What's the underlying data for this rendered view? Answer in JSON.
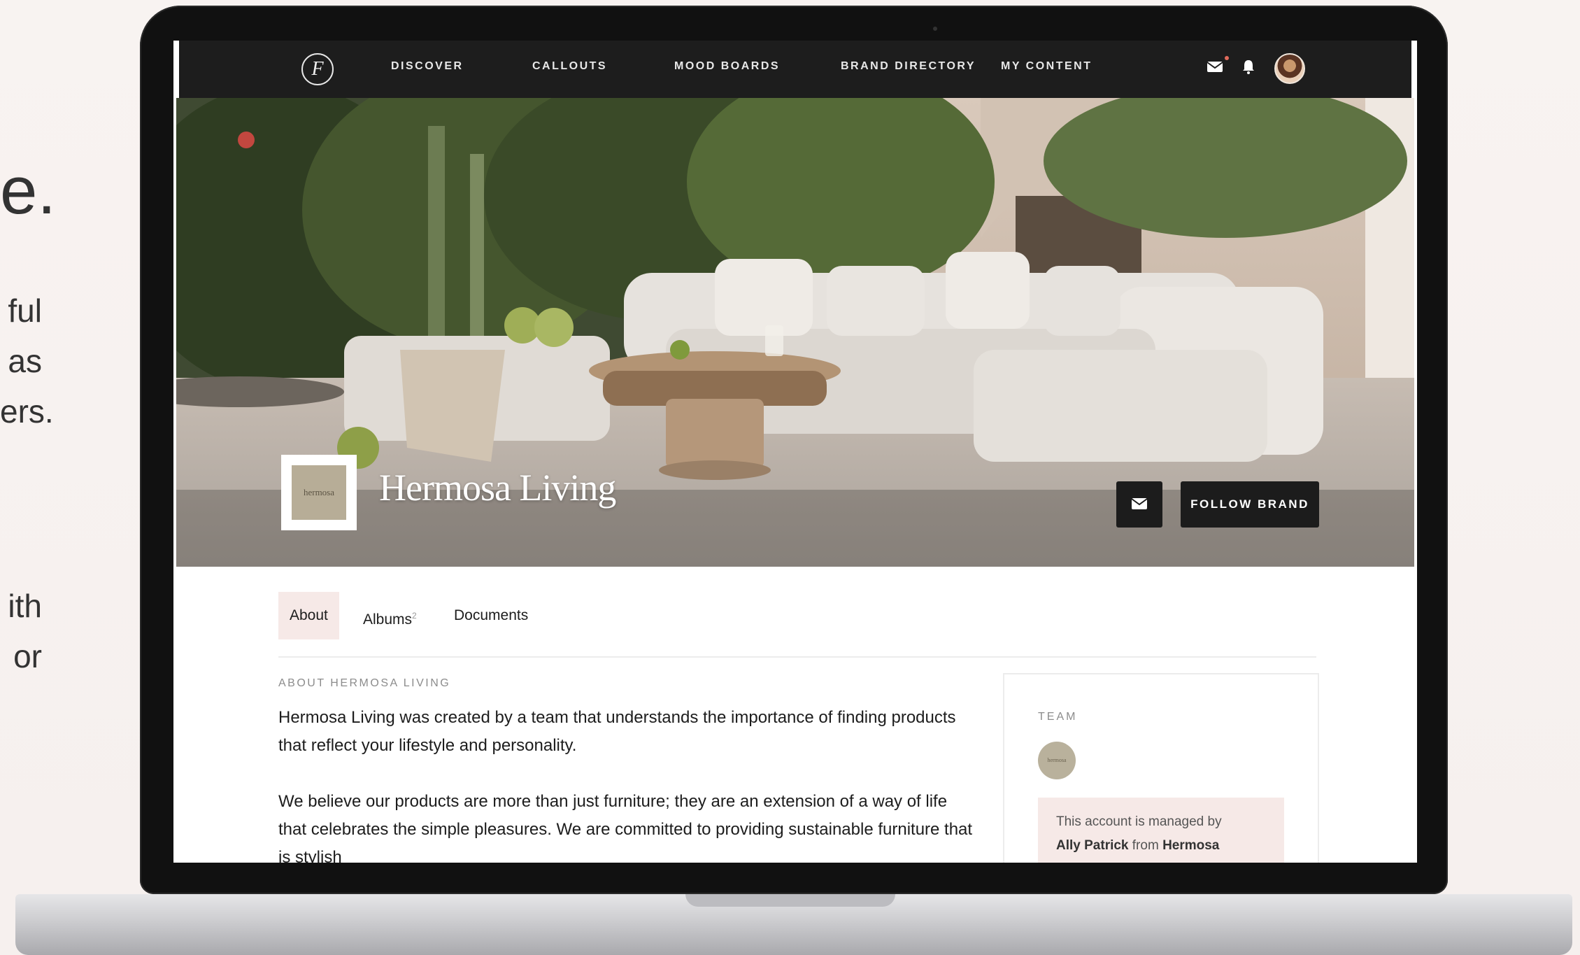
{
  "side_copy": {
    "headline_fragment": "e.",
    "lines": [
      "ful",
      "as",
      "ers.",
      "ith",
      "or"
    ]
  },
  "nav": {
    "logo_glyph": "F",
    "links": [
      "DISCOVER",
      "CALLOUTS",
      "MOOD BOARDS",
      "BRAND DIRECTORY",
      "MY CONTENT"
    ],
    "icons": [
      "mail-icon",
      "bell-icon"
    ]
  },
  "brand": {
    "logo_text": "hermosa",
    "name": "Hermosa Living",
    "follow_label": "FOLLOW BRAND"
  },
  "tabs": [
    {
      "label": "About",
      "count": ""
    },
    {
      "label": "Albums",
      "count": "2"
    },
    {
      "label": "Documents",
      "count": ""
    }
  ],
  "about": {
    "heading": "ABOUT HERMOSA LIVING",
    "paragraphs": [
      "Hermosa Living was created by a team that understands the importance of finding products that reflect your lifestyle and personality.",
      "We believe our products are more than just furniture; they are an extension of a way of life that celebrates the simple pleasures. We are committed to providing sustainable furniture that is stylish"
    ]
  },
  "team": {
    "label": "TEAM",
    "avatar_text": "hermosa",
    "managed_prefix": "This account is managed by",
    "manager_name": "Ally Patrick",
    "from_word": "from",
    "company": "Hermosa"
  },
  "colors": {
    "nav_bg": "#1d1d1d",
    "accent_pink": "#f6e9e7",
    "button_dark": "#1c1c1c"
  }
}
